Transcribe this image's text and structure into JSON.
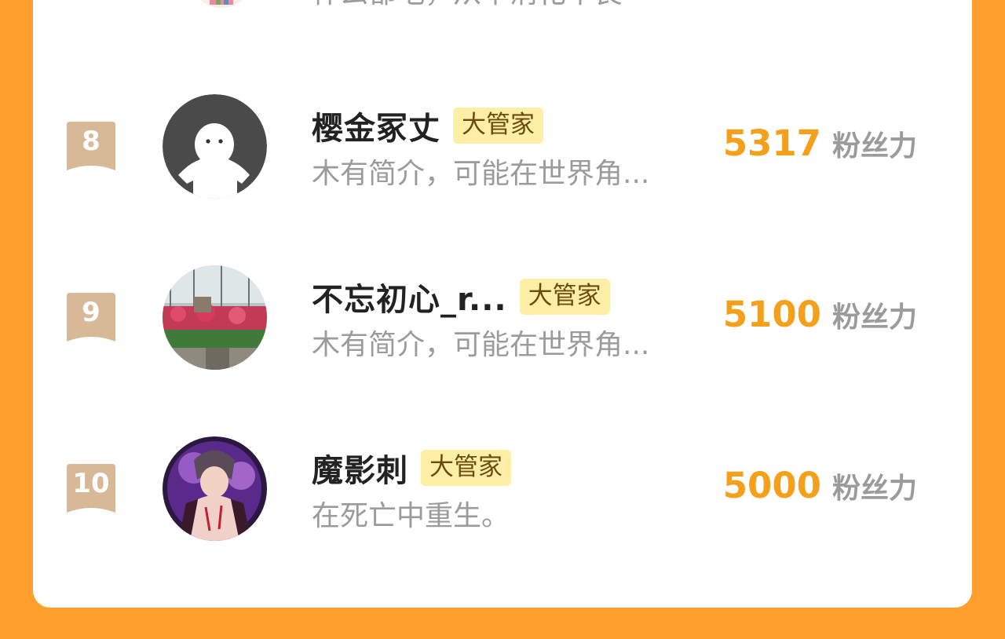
{
  "colors": {
    "page_background": "#ff9f2e",
    "card_background": "#ffffff",
    "score_color": "#f5a01a",
    "badge_background": "#fdf0a6",
    "badge_text": "#6b4b10",
    "muted_text": "#9b9b9b",
    "name_text": "#222222",
    "rank_ribbon": "#d7b897"
  },
  "partial_row": {
    "desc": "什么都吃，从不消化不良"
  },
  "leaderboard": {
    "rows": [
      {
        "rank": "8",
        "name": "樱金冢丈",
        "badge": "大管家",
        "desc": "木有简介，可能在世界角...",
        "score": "5317",
        "score_label": "粉丝力",
        "avatar_icon": "default-avatar-icon"
      },
      {
        "rank": "9",
        "name": "不忘初心_r...",
        "badge": "大管家",
        "desc": "木有简介，可能在世界角...",
        "score": "5100",
        "score_label": "粉丝力",
        "avatar_icon": "garden-photo-avatar"
      },
      {
        "rank": "10",
        "name": "魔影刺",
        "badge": "大管家",
        "desc": "在死亡中重生。",
        "score": "5000",
        "score_label": "粉丝力",
        "avatar_icon": "anime-character-avatar"
      }
    ]
  }
}
